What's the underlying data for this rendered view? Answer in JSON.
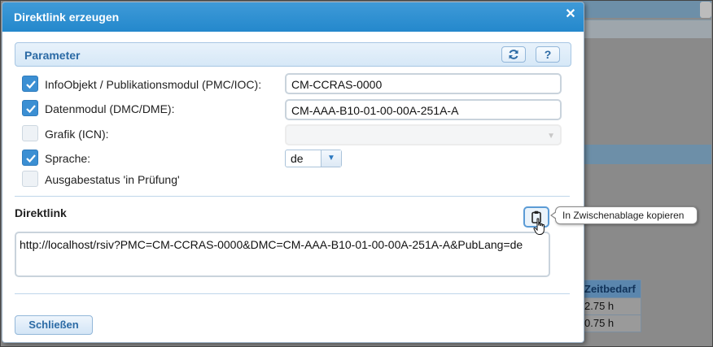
{
  "dialog": {
    "title": "Direktlink erzeugen",
    "close_icon": "close-icon"
  },
  "parameter": {
    "header": "Parameter",
    "refresh_icon": "refresh-icon",
    "help_label": "?",
    "rows": [
      {
        "label": "InfoObjekt / Publikationsmodul (PMC/IOC):",
        "checked": true,
        "value": "CM-CCRAS-0000"
      },
      {
        "label": "Datenmodul (DMC/DME):",
        "checked": true,
        "value": "CM-AAA-B10-01-00-00A-251A-A"
      },
      {
        "label": "Grafik (ICN):",
        "checked": false,
        "value": ""
      },
      {
        "label": "Sprache:",
        "checked": true,
        "value": "de"
      },
      {
        "label": "Ausgabestatus 'in Prüfung'",
        "checked": false
      }
    ]
  },
  "direktlink": {
    "label": "Direktlink",
    "copy_icon": "clipboard-icon",
    "tooltip": "In Zwischenablage kopieren",
    "url": "http://localhost/rsiv?PMC=CM-CCRAS-0000&DMC=CM-AAA-B10-01-00-00A-251A-A&PubLang=de"
  },
  "footer": {
    "close_label": "Schließen"
  },
  "background": {
    "table_header": "Zeitbedarf",
    "table_rows": [
      "2.75 h",
      "0.75 h"
    ]
  },
  "colors": {
    "accent": "#2488cc",
    "checkbox_checked": "#3b8fd3",
    "header_text": "#2b6aa5"
  }
}
